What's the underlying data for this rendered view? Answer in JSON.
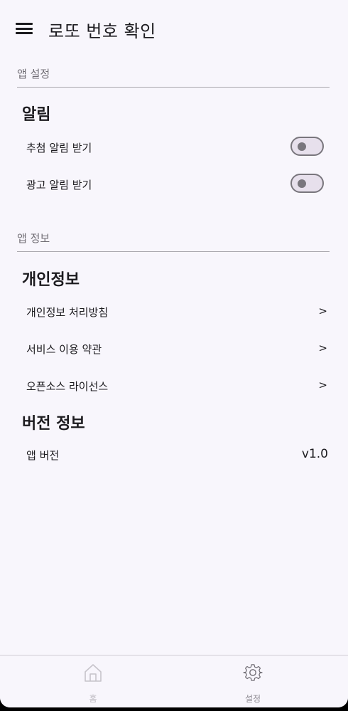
{
  "app_bar": {
    "title": "로또 번호 확인",
    "menu_icon": "hamburger-menu-icon"
  },
  "app_settings": {
    "section_label": "앱 설정",
    "notifications": {
      "title": "알림",
      "items": [
        {
          "label": "추첨 알림 받기",
          "enabled": false
        },
        {
          "label": "광고 알림 받기",
          "enabled": false
        }
      ]
    }
  },
  "app_info": {
    "section_label": "앱 정보",
    "privacy": {
      "title": "개인정보",
      "items": [
        {
          "label": "개인정보 처리방침",
          "chevron": ">"
        },
        {
          "label": "서비스 이용 약관",
          "chevron": ">"
        },
        {
          "label": "오픈소스 라이선스",
          "chevron": ">"
        }
      ]
    },
    "version": {
      "title": "버전 정보",
      "label": "앱 버전",
      "value": "v1.0"
    }
  },
  "bottom_nav": {
    "items": [
      {
        "label": "홈",
        "icon": "home-icon",
        "selected": false
      },
      {
        "label": "설정",
        "icon": "gear-icon",
        "selected": true
      }
    ]
  },
  "colors": {
    "background": "#f8f6fc",
    "switch_off_track": "#e7e0ec",
    "switch_off_thumb": "#79767d"
  }
}
